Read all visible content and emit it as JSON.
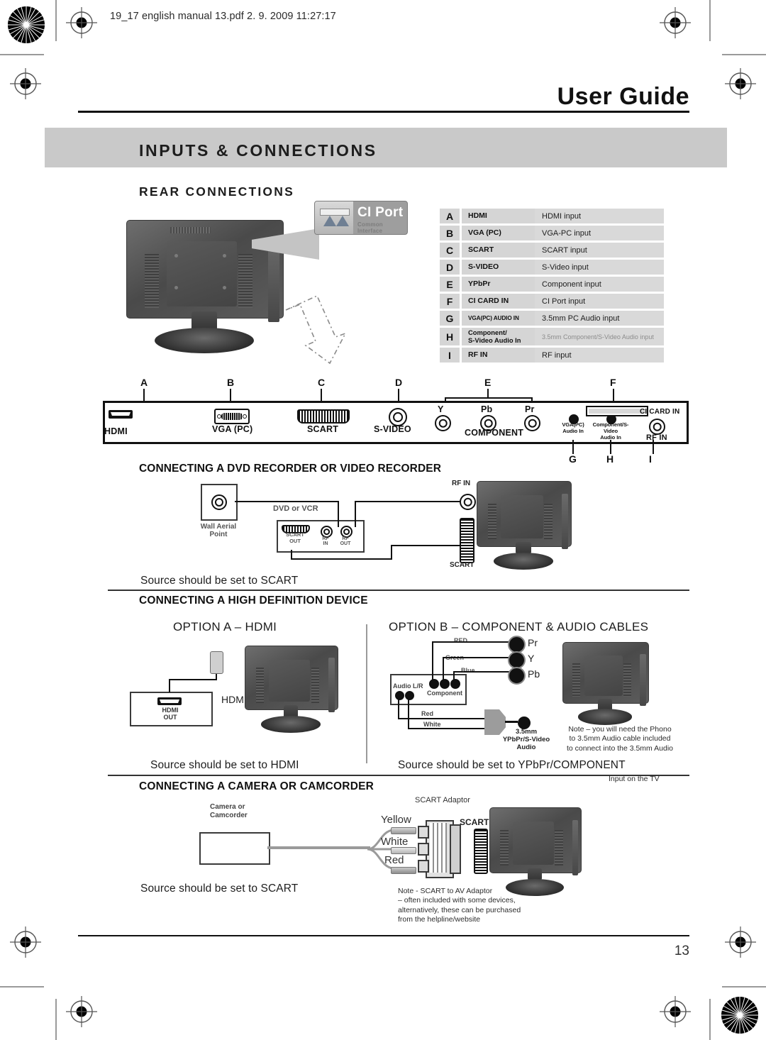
{
  "print_slug": "19_17 english manual 13.pdf   2. 9. 2009   11:27:17",
  "header": {
    "title": "User Guide"
  },
  "section": {
    "band_title": "INPUTS & CONNECTIONS",
    "rear_connections_title": "REAR CONNECTIONS"
  },
  "ci_port_badge": {
    "title": "CI Port",
    "subtitle": "Common Interface"
  },
  "legend": {
    "rows": [
      {
        "key": "A",
        "name": "HDMI",
        "desc": "HDMI input"
      },
      {
        "key": "B",
        "name": "VGA (PC)",
        "desc": "VGA-PC input"
      },
      {
        "key": "C",
        "name": "SCART",
        "desc": "SCART input"
      },
      {
        "key": "D",
        "name": "S-VIDEO",
        "desc": "S-Video input"
      },
      {
        "key": "E",
        "name": "YPbPr",
        "desc": "Component input"
      },
      {
        "key": "F",
        "name": "CI CARD IN",
        "desc": "CI Port input"
      },
      {
        "key": "G",
        "name": "VGA(PC) AUDIO IN",
        "desc": "3.5mm  PC Audio input"
      },
      {
        "key": "H",
        "name": "Component/\nS-Video Audio In",
        "desc": "3.5mm Component/S-Video Audio input"
      },
      {
        "key": "I",
        "name": "RF IN",
        "desc": "RF input"
      }
    ]
  },
  "panel": {
    "letters_top": [
      "A",
      "B",
      "C",
      "D",
      "E",
      "F"
    ],
    "letters_bottom": [
      "G",
      "H",
      "I"
    ],
    "labels": {
      "hdmi": "HDMI",
      "vga": "VGA (PC)",
      "scart": "SCART",
      "svideo": "S-VIDEO",
      "y": "Y",
      "pb": "Pb",
      "pr": "Pr",
      "component": "COMPONENT",
      "vga_audio": "VGA(PC)\nAudio In",
      "comp_audio": "Component/S-Video\nAudio In",
      "ci_card": "CI CARD IN",
      "rf_in": "RF IN"
    }
  },
  "dvd_section": {
    "title": "CONNECTING A DVD RECORDER OR VIDEO RECORDER",
    "wall_aerial": "Wall Aerial\nPoint",
    "device_label": "DVD or VCR",
    "scart_out": "SCART\nOUT",
    "rf_in": "RF\nIN",
    "rf_out": "RF\nOUT",
    "tv_rf_in": "RF IN",
    "tv_scart": "SCART",
    "source_note": "Source should be set to SCART"
  },
  "hd_section": {
    "title": "CONNECTING A HIGH DEFINITION DEVICE",
    "option_a": {
      "title": "OPTION A – HDMI",
      "device_port": "HDMI\nOUT",
      "tv_port": "HDMI",
      "source_note": "Source should be set to HDMI"
    },
    "option_b": {
      "title": "OPTION B – COMPONENT & AUDIO CABLES",
      "wire_red": "RED",
      "wire_green": "Green",
      "wire_blue": "Blue",
      "audio_lr": "Audio L/R",
      "component": "Component",
      "wire_red2": "Red",
      "wire_white": "White",
      "jack_pr": "Pr",
      "jack_y": "Y",
      "jack_pb": "Pb",
      "jack_3p5": "3.5mm\nYPbPr/S-Video\nAudio",
      "note": "Note – you will need the Phono\nto 3.5mm Audio cable included\nto connect into the 3.5mm Audio",
      "note_cont": "Input on the TV",
      "source_note": "Source should be set to YPbPr/COMPONENT"
    }
  },
  "camera_section": {
    "title": "CONNECTING A CAMERA OR CAMCORDER",
    "device_label": "Camera or\nCamcorder",
    "adaptor_label": "SCART Adaptor",
    "wire_yellow": "Yellow",
    "wire_white": "White",
    "wire_red": "Red",
    "tv_scart": "SCART",
    "note": "Note - SCART to AV Adaptor\n– often included with some devices,\nalternatively, these can be purchased\nfrom the helpline/website",
    "source_note": "Source should be set to SCART"
  },
  "footer": {
    "page_number": "13"
  },
  "colors": {
    "band_gray": "#c9c9c9",
    "legend_key_gray": "#d5d5d5",
    "legend_val_gray": "#d9d9d9",
    "ink": "#111111",
    "reg_mark": "#000000"
  }
}
